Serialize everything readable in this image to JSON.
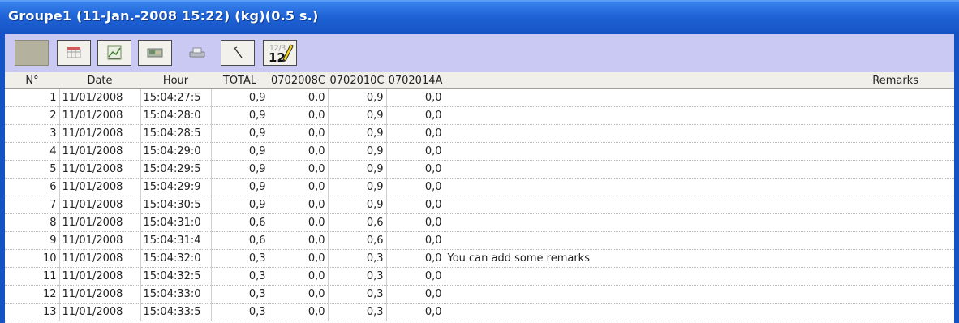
{
  "window": {
    "title": "Groupe1 (11-Jan.-2008 15:22) (kg)(0.5 s.)"
  },
  "toolbar": {
    "buttons": [
      {
        "name": "color-swatch-button",
        "icon": "color-swatch"
      },
      {
        "name": "table-view-button",
        "icon": "table-icon"
      },
      {
        "name": "chart-view-button",
        "icon": "chart-icon"
      },
      {
        "name": "image-button",
        "icon": "picture-icon"
      },
      {
        "name": "print-button",
        "icon": "printer-icon"
      },
      {
        "name": "line-tool-button",
        "icon": "line-icon"
      },
      {
        "name": "numbering-button",
        "icon": "number-edit-icon",
        "text_top": "12/3",
        "text_main": "12"
      }
    ]
  },
  "table": {
    "columns": [
      "N°",
      "Date",
      "Hour",
      "TOTAL",
      "0702008C",
      "0702010C",
      "0702014A",
      "Remarks"
    ],
    "rows": [
      [
        "1",
        "11/01/2008",
        "15:04:27:5",
        "0,9",
        "0,0",
        "0,9",
        "0,0",
        ""
      ],
      [
        "2",
        "11/01/2008",
        "15:04:28:0",
        "0,9",
        "0,0",
        "0,9",
        "0,0",
        ""
      ],
      [
        "3",
        "11/01/2008",
        "15:04:28:5",
        "0,9",
        "0,0",
        "0,9",
        "0,0",
        ""
      ],
      [
        "4",
        "11/01/2008",
        "15:04:29:0",
        "0,9",
        "0,0",
        "0,9",
        "0,0",
        ""
      ],
      [
        "5",
        "11/01/2008",
        "15:04:29:5",
        "0,9",
        "0,0",
        "0,9",
        "0,0",
        ""
      ],
      [
        "6",
        "11/01/2008",
        "15:04:29:9",
        "0,9",
        "0,0",
        "0,9",
        "0,0",
        ""
      ],
      [
        "7",
        "11/01/2008",
        "15:04:30:5",
        "0,9",
        "0,0",
        "0,9",
        "0,0",
        ""
      ],
      [
        "8",
        "11/01/2008",
        "15:04:31:0",
        "0,6",
        "0,0",
        "0,6",
        "0,0",
        ""
      ],
      [
        "9",
        "11/01/2008",
        "15:04:31:4",
        "0,6",
        "0,0",
        "0,6",
        "0,0",
        ""
      ],
      [
        "10",
        "11/01/2008",
        "15:04:32:0",
        "0,3",
        "0,0",
        "0,3",
        "0,0",
        "You can add some remarks"
      ],
      [
        "11",
        "11/01/2008",
        "15:04:32:5",
        "0,3",
        "0,0",
        "0,3",
        "0,0",
        ""
      ],
      [
        "12",
        "11/01/2008",
        "15:04:33:0",
        "0,3",
        "0,0",
        "0,3",
        "0,0",
        ""
      ],
      [
        "13",
        "11/01/2008",
        "15:04:33:5",
        "0,3",
        "0,0",
        "0,3",
        "0,0",
        ""
      ]
    ]
  }
}
